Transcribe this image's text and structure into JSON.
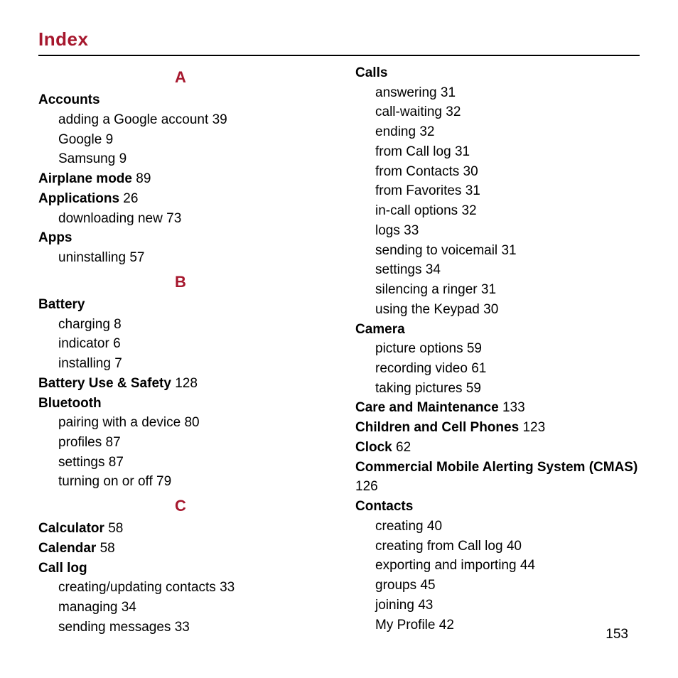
{
  "title": "Index",
  "page_number": "153",
  "left": [
    {
      "type": "letter",
      "text": "A"
    },
    {
      "type": "head",
      "text": "Accounts"
    },
    {
      "type": "sub",
      "text": "adding a Google account",
      "page": "39"
    },
    {
      "type": "sub",
      "text": "Google",
      "page": "9"
    },
    {
      "type": "sub",
      "text": "Samsung",
      "page": "9"
    },
    {
      "type": "head_inline",
      "text": "Airplane mode",
      "page": "89"
    },
    {
      "type": "head_inline",
      "text": "Applications",
      "page": "26"
    },
    {
      "type": "sub",
      "text": "downloading new",
      "page": "73"
    },
    {
      "type": "head",
      "text": "Apps"
    },
    {
      "type": "sub",
      "text": "uninstalling",
      "page": "57"
    },
    {
      "type": "letter",
      "text": "B"
    },
    {
      "type": "head",
      "text": "Battery"
    },
    {
      "type": "sub",
      "text": "charging",
      "page": "8"
    },
    {
      "type": "sub",
      "text": "indicator",
      "page": "6"
    },
    {
      "type": "sub",
      "text": "installing",
      "page": "7"
    },
    {
      "type": "head_inline",
      "text": "Battery Use & Safety",
      "page": "128"
    },
    {
      "type": "head",
      "text": "Bluetooth"
    },
    {
      "type": "sub",
      "text": "pairing with a device",
      "page": "80"
    },
    {
      "type": "sub",
      "text": "profiles",
      "page": "87"
    },
    {
      "type": "sub",
      "text": "settings",
      "page": "87"
    },
    {
      "type": "sub",
      "text": "turning on or off",
      "page": "79"
    },
    {
      "type": "letter",
      "text": "C"
    },
    {
      "type": "head_inline",
      "text": "Calculator",
      "page": "58"
    },
    {
      "type": "head_inline",
      "text": "Calendar",
      "page": "58"
    },
    {
      "type": "head",
      "text": "Call log"
    },
    {
      "type": "sub",
      "text": "creating/updating contacts",
      "page": "33"
    },
    {
      "type": "sub",
      "text": "managing",
      "page": "34"
    },
    {
      "type": "sub",
      "text": "sending messages",
      "page": "33"
    }
  ],
  "right": [
    {
      "type": "head",
      "text": "Calls"
    },
    {
      "type": "sub",
      "text": "answering",
      "page": "31"
    },
    {
      "type": "sub",
      "text": "call-waiting",
      "page": "32"
    },
    {
      "type": "sub",
      "text": "ending",
      "page": "32"
    },
    {
      "type": "sub",
      "text": "from Call log",
      "page": "31"
    },
    {
      "type": "sub",
      "text": "from Contacts",
      "page": "30"
    },
    {
      "type": "sub",
      "text": "from Favorites",
      "page": "31"
    },
    {
      "type": "sub",
      "text": "in-call options",
      "page": "32"
    },
    {
      "type": "sub",
      "text": "logs",
      "page": "33"
    },
    {
      "type": "sub",
      "text": "sending to voicemail",
      "page": "31"
    },
    {
      "type": "sub",
      "text": "settings",
      "page": "34"
    },
    {
      "type": "sub",
      "text": "silencing a ringer",
      "page": "31"
    },
    {
      "type": "sub",
      "text": "using the Keypad",
      "page": "30"
    },
    {
      "type": "head",
      "text": "Camera"
    },
    {
      "type": "sub",
      "text": "picture options",
      "page": "59"
    },
    {
      "type": "sub",
      "text": "recording video",
      "page": "61"
    },
    {
      "type": "sub",
      "text": "taking pictures",
      "page": "59"
    },
    {
      "type": "head_inline",
      "text": "Care and Maintenance",
      "page": "133"
    },
    {
      "type": "head_inline",
      "text": "Children and Cell Phones",
      "page": "123"
    },
    {
      "type": "head_inline",
      "text": "Clock",
      "page": "62"
    },
    {
      "type": "head_wrap",
      "text": "Commercial Mobile Alerting System (CMAS)",
      "page": "126"
    },
    {
      "type": "head",
      "text": "Contacts"
    },
    {
      "type": "sub",
      "text": "creating",
      "page": "40"
    },
    {
      "type": "sub",
      "text": "creating from Call log",
      "page": "40"
    },
    {
      "type": "sub",
      "text": "exporting and importing",
      "page": "44"
    },
    {
      "type": "sub",
      "text": "groups",
      "page": "45"
    },
    {
      "type": "sub",
      "text": "joining",
      "page": "43"
    },
    {
      "type": "sub",
      "text": "My Profile",
      "page": "42"
    }
  ]
}
